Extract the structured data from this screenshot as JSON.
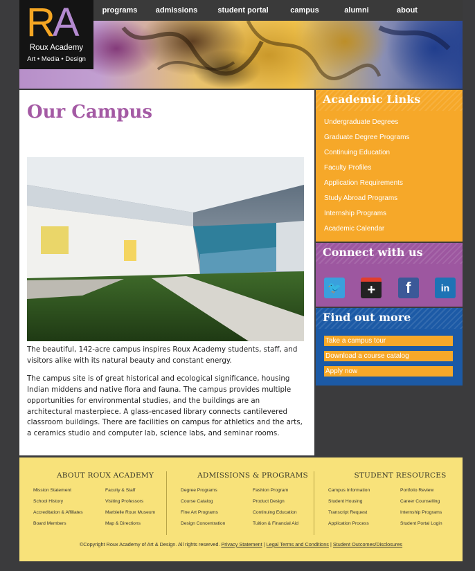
{
  "logo": {
    "mark_r": "R",
    "mark_a": "A",
    "name": "Roux Academy",
    "tagline": "Art • Media • Design"
  },
  "nav": [
    "programs",
    "admissions",
    "student portal",
    "campus",
    "alumni",
    "about"
  ],
  "main": {
    "title": "Our Campus",
    "paragraphs": [
      "The beautiful, 142-acre campus inspires Roux Academy students, staff, and visitors alike with its natural beauty and constant energy.",
      "The campus site is of great historical and ecological significance, housing Indian middens and native flora and fauna. The campus provides multiple opportunities for environmental studies, and the buildings are an architectural masterpiece. A glass-encased library connects cantilevered classroom buildings. There are facilities on campus for athletics and the arts, a ceramics studio and computer lab, science labs, and seminar rooms."
    ]
  },
  "sidebar": {
    "academic": {
      "title": "Academic Links",
      "links": [
        "Undergraduate Degrees",
        "Graduate Degree Programs",
        "Continuing Education",
        "Faculty Profiles",
        "Application Requirements",
        "Study Abroad Programs",
        "Internship Programs",
        "Academic Calendar"
      ]
    },
    "connect": {
      "title": "Connect with us",
      "icons": [
        "twitter-icon",
        "google-plus-icon",
        "facebook-icon",
        "linkedin-icon"
      ],
      "glyphs": [
        "🐦",
        "+",
        "f",
        "in"
      ]
    },
    "findout": {
      "title": "Find out more",
      "links": [
        "Take a campus tour",
        "Download a course catalog",
        "Apply now"
      ]
    }
  },
  "footer": {
    "columns": [
      {
        "title": "ABOUT ROUX ACADEMY",
        "links": [
          "Mission Statement",
          "Faculty & Staff",
          "School History",
          "Visiting Professors",
          "Accreditation & Affiliates",
          "Marbielle Roux Museum",
          "Board Members",
          "Map & Directions"
        ]
      },
      {
        "title": "ADMISSIONS & PROGRAMS",
        "links": [
          "Degree Programs",
          "Fashion Program",
          "Course Catalog",
          "Product Design",
          "Fine Art Programs",
          "Continuing Education",
          "Design Concentration",
          "Tuition & Financial Aid"
        ]
      },
      {
        "title": "STUDENT RESOURCES",
        "links": [
          "Campus Information",
          "Portfolio Review",
          "Student Housing",
          "Career Counselling",
          "Transcript Request",
          "Internship Programs",
          "Application Process",
          "Student Portal Login"
        ]
      }
    ],
    "copyright": "©Copyright Roux Academy of Art & Design. All rights reserved.",
    "legal_links": [
      "Privacy Statement",
      "Legal Terms and Conditions",
      "Student Outcomes/Disclosures"
    ]
  },
  "colors": {
    "accent_purple": "#a45aa4",
    "orange": "#f6a829",
    "blue": "#1c5aa6",
    "footer": "#f8e27a"
  }
}
